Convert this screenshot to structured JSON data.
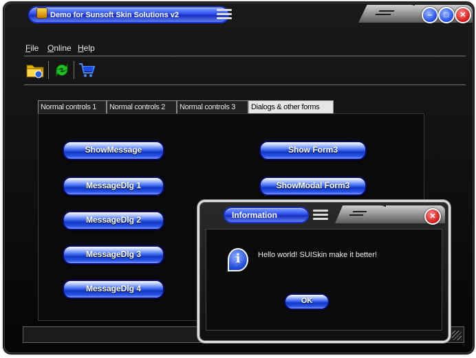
{
  "window": {
    "title": "Demo for Sunsoft Skin Solutions v2",
    "menu": [
      {
        "label": "File",
        "accel": "F",
        "rest": "ile"
      },
      {
        "label": "Online",
        "accel": "O",
        "rest": "nline"
      },
      {
        "label": "Help",
        "accel": "H",
        "rest": "elp"
      }
    ],
    "toolbar": {
      "open_icon": "folder-open-icon",
      "refresh_icon": "refresh-icon",
      "cart_icon": "shopping-cart-icon"
    },
    "caption_buttons": {
      "minimize": "minimize-icon",
      "maximize": "maximize-icon",
      "close": "close-icon"
    }
  },
  "tabs": [
    {
      "label": "Normal controls 1",
      "active": false
    },
    {
      "label": "Normal controls 2",
      "active": false
    },
    {
      "label": "Normal controls 3",
      "active": false
    },
    {
      "label": "Dialogs & other forms",
      "active": true
    }
  ],
  "buttons": {
    "show_message": "ShowMessage",
    "message_dlg_1": "MessageDlg 1",
    "message_dlg_2": "MessageDlg 2",
    "message_dlg_3": "MessageDlg 3",
    "message_dlg_4": "MessageDlg 4",
    "show_form3": "Show Form3",
    "show_modal_form3": "ShowModal Form3"
  },
  "dialog": {
    "title": "Information",
    "message": "Hello world! SUISkin make it better!",
    "ok": "OK",
    "icon": "information-icon"
  },
  "colors": {
    "accent_blue": "#1e4be8",
    "close_red": "#d41414",
    "background": "#0a0a0a"
  }
}
